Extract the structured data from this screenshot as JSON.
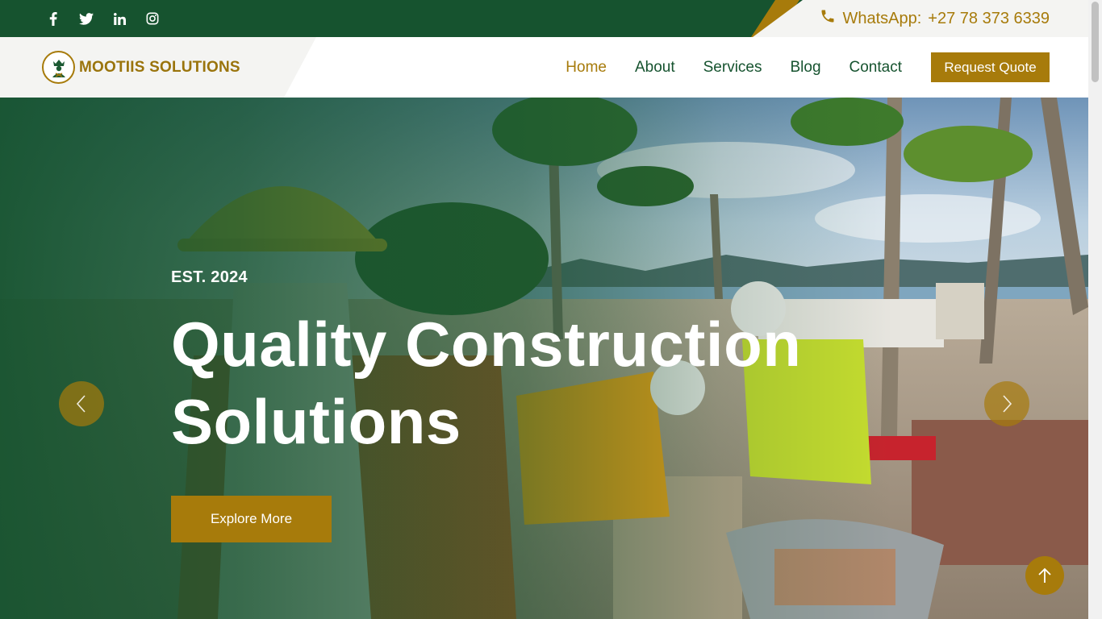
{
  "topbar": {
    "socials": [
      {
        "icon": "facebook-icon"
      },
      {
        "icon": "twitter-icon"
      },
      {
        "icon": "linkedin-icon"
      },
      {
        "icon": "instagram-icon"
      }
    ],
    "whatsapp_label": "WhatsApp:",
    "whatsapp_number": "+27 78 373 6339"
  },
  "nav": {
    "brand": "MOOTIIS SOLUTIONS",
    "links": [
      "Home",
      "About",
      "Services",
      "Blog",
      "Contact"
    ],
    "active": "Home",
    "cta": "Request Quote"
  },
  "hero": {
    "est": "EST. 2024",
    "title_line1": "Quality Construction",
    "title_line2": "Solutions",
    "button": "Explore More"
  },
  "colors": {
    "primary_green": "#16532f",
    "accent_gold": "#a77b0b",
    "light_bg": "#f4f4f2"
  }
}
